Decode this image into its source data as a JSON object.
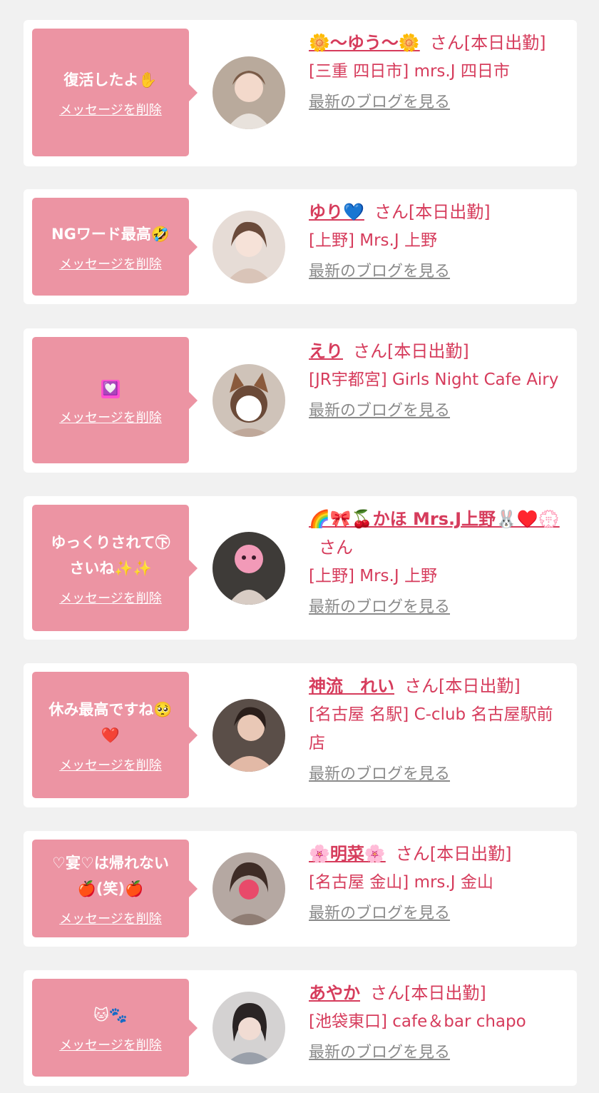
{
  "delete_label": "メッセージを削除",
  "blog_label": "最新のブログを見る",
  "san_label": "さん",
  "colors": {
    "bubble": "#ec94a3",
    "accent": "#d63c5c",
    "blog_link": "#8a8a8a",
    "background": "#f1f1f1"
  },
  "items": [
    {
      "message": "復活したよ✋",
      "name": "🌼〜ゆう〜🌼",
      "suffix": "さん[本日出勤]",
      "shop": "[三重 四日市] mrs.J 四日市",
      "avatar": "avatar-photo"
    },
    {
      "message": "NGワード最高🤣",
      "name": "ゆり💙",
      "suffix": "さん[本日出勤]",
      "shop": "[上野] Mrs.J 上野",
      "avatar": "avatar-photo"
    },
    {
      "message": "💟",
      "name": "えり",
      "suffix": "さん[本日出勤]",
      "shop": "[JR宇都宮] Girls Night Cafe Airy",
      "avatar": "avatar-photo"
    },
    {
      "message": "ゆっくりされて㊦\nさいね✨✨",
      "name": "🌈🎀🍒かほ Mrs.J上野🐰♥️💮",
      "suffix": "さん",
      "shop": "[上野] Mrs.J 上野",
      "avatar": "avatar-photo"
    },
    {
      "message": "休み最高ですね🥺\n❤️",
      "name": "神流　れい",
      "suffix": "さん[本日出勤]",
      "shop": "[名古屋 名駅] C-club 名古屋駅前店",
      "avatar": "avatar-photo"
    },
    {
      "message": "♡宴♡は帰れない\n🍎(笑)🍎",
      "name": "🌸明菜🌸",
      "suffix": "さん[本日出勤]",
      "shop": "[名古屋 金山] mrs.J 金山",
      "avatar": "avatar-photo"
    },
    {
      "message": "🐱🐾",
      "name": "あやか",
      "suffix": "さん[本日出勤]",
      "shop": "[池袋東口] cafe＆bar chapo",
      "avatar": "avatar-photo"
    }
  ]
}
